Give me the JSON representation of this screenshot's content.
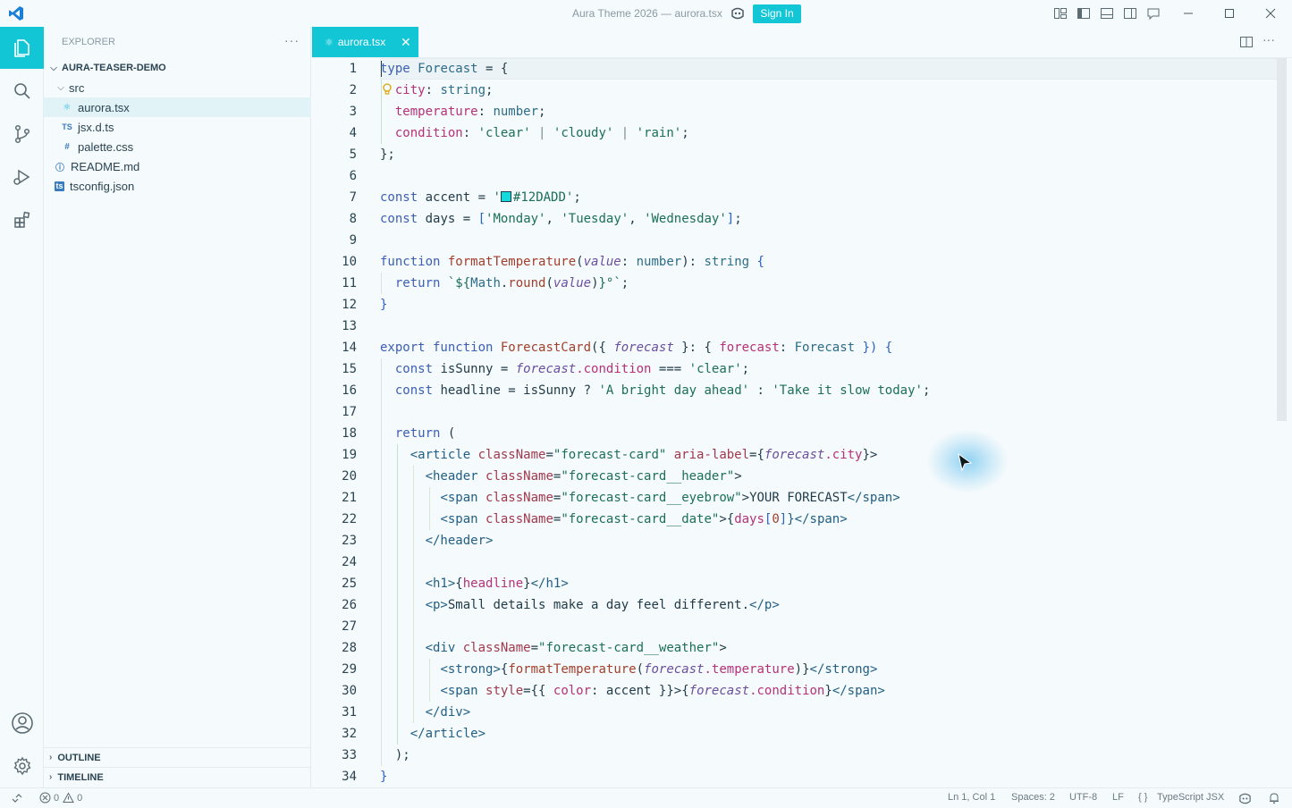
{
  "window": {
    "title": "Aura Theme 2026 — aurora.tsx",
    "signin_label": "Sign In"
  },
  "activity_bar": {
    "items": [
      {
        "icon": "files-icon",
        "active": true
      },
      {
        "icon": "search-icon"
      },
      {
        "icon": "source-control-icon"
      },
      {
        "icon": "run-debug-icon"
      },
      {
        "icon": "extensions-icon"
      }
    ],
    "bottom": [
      {
        "icon": "account-icon"
      },
      {
        "icon": "gear-icon"
      }
    ]
  },
  "sidebar": {
    "title": "EXPLORER",
    "more": "···",
    "root": "AURA-TEASER-DEMO",
    "tree": [
      {
        "label": "src",
        "type": "folder",
        "icon": "chevron-down"
      },
      {
        "label": "aurora.tsx",
        "type": "file",
        "icon": "⚛",
        "selected": true
      },
      {
        "label": "jsx.d.ts",
        "type": "file",
        "icon": "TS"
      },
      {
        "label": "palette.css",
        "type": "file",
        "icon": "#"
      },
      {
        "label": "README.md",
        "type": "file",
        "icon": "ⓘ"
      },
      {
        "label": "tsconfig.json",
        "type": "file",
        "icon": "ts"
      }
    ],
    "sections": [
      "OUTLINE",
      "TIMELINE"
    ]
  },
  "tabs": [
    {
      "label": "aurora.tsx",
      "icon": "⚛",
      "close": "✕"
    }
  ],
  "editor": {
    "line_numbers": [
      "1",
      "2",
      "3",
      "4",
      "5",
      "6",
      "7",
      "8",
      "9",
      "10",
      "11",
      "12",
      "13",
      "14",
      "15",
      "16",
      "17",
      "18",
      "19",
      "20",
      "21",
      "22",
      "23",
      "24",
      "25",
      "26",
      "27",
      "28",
      "29",
      "30",
      "31",
      "32",
      "33",
      "34"
    ],
    "tokens": {
      "l1a": "type",
      "l1b": "Forecast",
      "l1c": " = {",
      "l2a": "city",
      "l2b": ": ",
      "l2c": "string",
      "l2d": ";",
      "l3a": "temperature",
      "l3b": ": ",
      "l3c": "number",
      "l3d": ";",
      "l4a": "condition",
      "l4b": ": ",
      "l4c": "'clear'",
      "l4d": " | ",
      "l4e": "'cloudy'",
      "l4f": " | ",
      "l4g": "'rain'",
      "l4h": ";",
      "l5a": "};",
      "l7a": "const",
      "l7b": " accent",
      "l7c": " = ",
      "l7d": "'",
      "l7e": "#12DADD'",
      "l7f": ";",
      "l8a": "const",
      "l8b": " days",
      "l8c": " = ",
      "l8d": "[",
      "l8e": "'Monday'",
      "l8f": ", ",
      "l8g": "'Tuesday'",
      "l8h": ", ",
      "l8i": "'Wednesday'",
      "l8j": "]",
      "l8k": ";",
      "l10a": "function",
      "l10b": " formatTemperature",
      "l10c": "(",
      "l10d": "value",
      "l10e": ": ",
      "l10f": "number",
      "l10g": "): ",
      "l10h": "string",
      "l10i": " {",
      "l11a": "return",
      "l11b": " `${",
      "l11c": "Math",
      "l11d": ".",
      "l11e": "round",
      "l11f": "(",
      "l11g": "value",
      "l11h": ")",
      "l11i": "}°`",
      "l11j": ";",
      "l12a": "}",
      "l14a": "export",
      "l14b": " function",
      "l14c": " ForecastCard",
      "l14d": "({ ",
      "l14e": "forecast",
      "l14f": " }: { ",
      "l14g": "forecast",
      "l14h": ": ",
      "l14i": "Forecast",
      "l14j": " }) {",
      "l15a": "const",
      "l15b": " isSunny",
      "l15c": " = ",
      "l15d": "forecast",
      "l15e": ".condition",
      "l15f": " === ",
      "l15g": "'clear'",
      "l15h": ";",
      "l16a": "const",
      "l16b": " headline",
      "l16c": " = ",
      "l16d": "isSunny",
      "l16e": " ? ",
      "l16f": "'A bright day ahead'",
      "l16g": " : ",
      "l16h": "'Take it slow today'",
      "l16i": ";",
      "l18a": "return",
      "l18b": " (",
      "l19a": "<article",
      "l19b": " className",
      "l19c": "=",
      "l19d": "\"forecast-card\"",
      "l19e": " aria-label",
      "l19f": "={",
      "l19g": "forecast",
      "l19h": ".city",
      "l19i": "}>",
      "l20a": "<header",
      "l20b": " className",
      "l20c": "=",
      "l20d": "\"forecast-card__header\"",
      "l20e": ">",
      "l21a": "<span",
      "l21b": " className",
      "l21c": "=",
      "l21d": "\"forecast-card__eyebrow\"",
      "l21e": ">",
      "l21f": "YOUR FORECAST",
      "l21g": "</span>",
      "l22a": "<span",
      "l22b": " className",
      "l22c": "=",
      "l22d": "\"forecast-card__date\"",
      "l22e": ">{",
      "l22f": "days",
      "l22g": "[",
      "l22h": "0",
      "l22i": "]",
      "l22j": "}</span>",
      "l23a": "</header>",
      "l25a": "<h1>",
      "l25b": "{",
      "l25c": "headline",
      "l25d": "}",
      "l25e": "</h1>",
      "l26a": "<p>",
      "l26b": "Small details make a day feel different.",
      "l26c": "</p>",
      "l28a": "<div",
      "l28b": " className",
      "l28c": "=",
      "l28d": "\"forecast-card__weather\"",
      "l28e": ">",
      "l29a": "<strong>",
      "l29b": "{",
      "l29c": "formatTemperature",
      "l29d": "(",
      "l29e": "forecast",
      "l29f": ".temperature",
      "l29g": ")",
      "l29h": "}",
      "l29i": "</strong>",
      "l30a": "<span",
      "l30b": " style",
      "l30c": "={{ ",
      "l30d": "color",
      "l30e": ": ",
      "l30f": "accent",
      "l30g": " }}>",
      "l30h": "{",
      "l30i": "forecast",
      "l30j": ".condition",
      "l30k": "}",
      "l30l": "</span>",
      "l31a": "</div>",
      "l32a": "</article>",
      "l33a": ");",
      "l34a": "}"
    }
  },
  "statusbar": {
    "errors": "0",
    "warnings": "0",
    "position": "Ln 1, Col 1",
    "spaces": "Spaces: 2",
    "encoding": "UTF-8",
    "eol": "LF",
    "braces": "{ }",
    "language": "TypeScript JSX"
  },
  "colors": {
    "accent": "#12c6d6",
    "swatch": "#12DADD"
  }
}
